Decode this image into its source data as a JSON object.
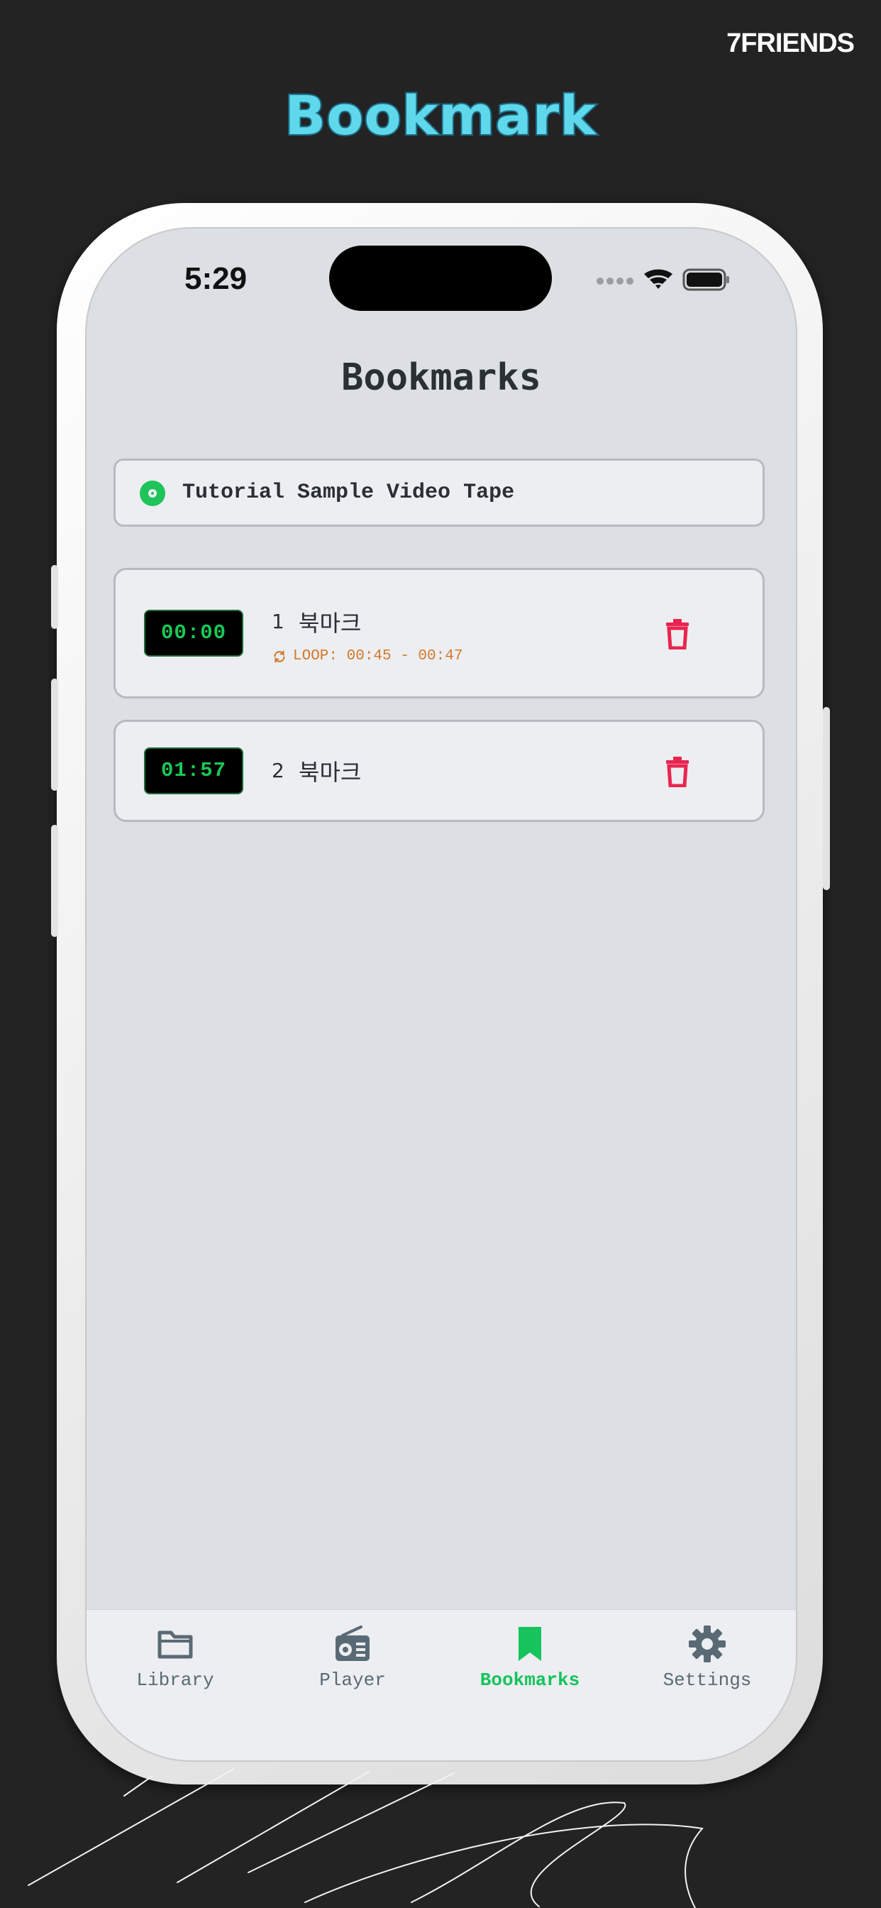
{
  "brand": "7FRIENDS",
  "promo_title": "Bookmark",
  "status": {
    "time": "5:29"
  },
  "screen_title": "Bookmarks",
  "tape": {
    "label": "Tutorial Sample Video Tape"
  },
  "bookmarks": [
    {
      "timecode": "00:00",
      "number": "1",
      "title": "북마크",
      "loop": "LOOP: 00:45 - 00:47"
    },
    {
      "timecode": "01:57",
      "number": "2",
      "title": "북마크"
    }
  ],
  "tabs": [
    {
      "label": "Library",
      "icon": "folder-icon",
      "active": false
    },
    {
      "label": "Player",
      "icon": "radio-icon",
      "active": false
    },
    {
      "label": "Bookmarks",
      "icon": "bookmark-icon",
      "active": true
    },
    {
      "label": "Settings",
      "icon": "gear-icon",
      "active": false
    }
  ],
  "colors": {
    "accent": "#16c35c",
    "delete": "#e8254f",
    "loop": "#d4782a",
    "background": "#232323"
  }
}
